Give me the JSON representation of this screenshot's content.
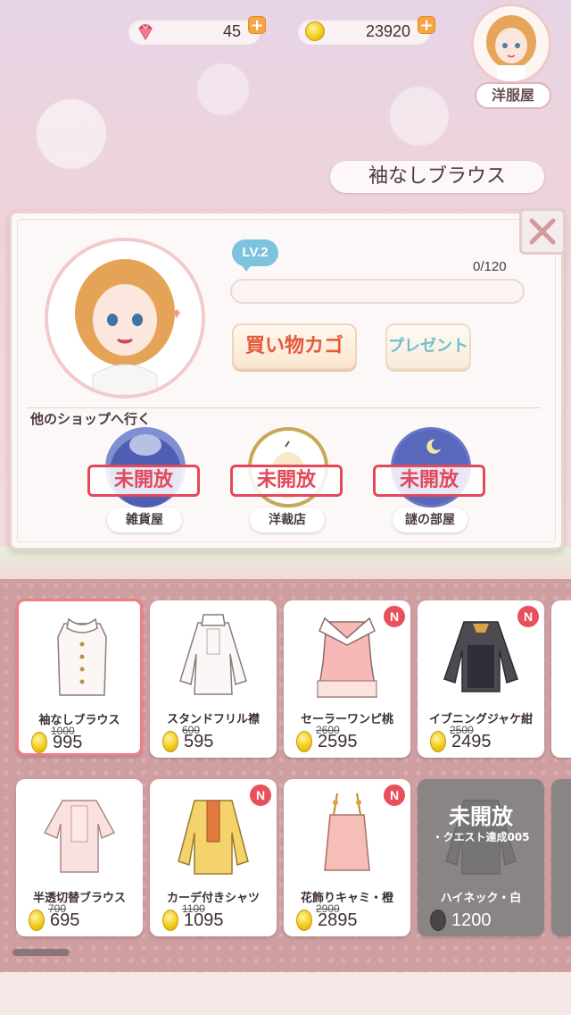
{
  "currency": {
    "gems": "45",
    "coins": "23920"
  },
  "profile": {
    "shop_name": "洋服屋"
  },
  "selected_item_title": "袖なしブラウス",
  "panel": {
    "level": "LV.2",
    "progress_text": "0/120",
    "progress_value": 0,
    "cart_button": "買い物カゴ",
    "gift_button": "プレゼント",
    "other_shops_label": "他のショップへ行く",
    "shops": [
      {
        "name": "雑貨屋",
        "status": "未開放"
      },
      {
        "name": "洋裁店",
        "status": "未開放"
      },
      {
        "name": "謎の部屋",
        "status": "未開放"
      }
    ]
  },
  "items": [
    {
      "name": "袖なしブラウス",
      "old_price": "1000",
      "price": "995",
      "new": false,
      "selected": true
    },
    {
      "name": "スタンドフリル襟",
      "old_price": "600",
      "price": "595",
      "new": false,
      "selected": false
    },
    {
      "name": "セーラーワンピ桃",
      "old_price": "2600",
      "price": "2595",
      "new": true,
      "badge": "N",
      "selected": false
    },
    {
      "name": "イブニングジャケ紺",
      "old_price": "2500",
      "price": "2495",
      "new": true,
      "badge": "N",
      "selected": false
    },
    {
      "name": "半透切替ブラウス",
      "old_price": "700",
      "price": "695",
      "new": false,
      "selected": false
    },
    {
      "name": "カーデ付きシャツ",
      "old_price": "1100",
      "price": "1095",
      "new": true,
      "badge": "N",
      "selected": false
    },
    {
      "name": "花飾りキャミ・橙",
      "old_price": "2900",
      "price": "2895",
      "new": true,
      "badge": "N",
      "selected": false
    },
    {
      "name": "ハイネック・白",
      "price": "1200",
      "locked": true,
      "lock_label": "未開放",
      "quest": "・クエスト達成005"
    }
  ],
  "colors": {
    "accent_red": "#e3485b",
    "new_badge": "#e8505b",
    "lv_badge": "#7cc4de",
    "coin": "#f2cc1a"
  },
  "icons": {
    "gem": "gem-icon",
    "coin": "coin-icon",
    "close": "close-icon",
    "plus": "plus-icon"
  }
}
